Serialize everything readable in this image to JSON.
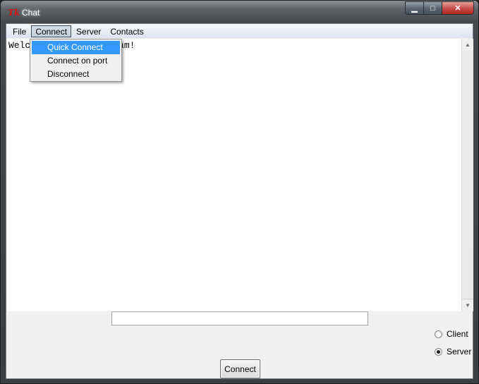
{
  "window": {
    "title": "Chat",
    "icon": "Tk",
    "controls": {
      "minimize": "▁",
      "maximize": "□",
      "close": "✕"
    }
  },
  "menubar": {
    "items": [
      {
        "label": "File"
      },
      {
        "label": "Connect",
        "active": true
      },
      {
        "label": "Server"
      },
      {
        "label": "Contacts"
      }
    ]
  },
  "connect_menu": {
    "items": [
      {
        "label": "Quick Connect",
        "highlighted": true
      },
      {
        "label": "Connect on port"
      },
      {
        "label": "Disconnect"
      }
    ]
  },
  "chat_log": {
    "text": "Welcome to the program!"
  },
  "message_entry": {
    "value": ""
  },
  "mode": {
    "options": [
      {
        "label": "Client",
        "selected": false
      },
      {
        "label": "Server",
        "selected": true
      }
    ]
  },
  "connect_button": {
    "label": "Connect"
  },
  "colors": {
    "menu_highlight": "#3399ff",
    "tk_icon": "#d21414",
    "close_button": "#c75050"
  }
}
